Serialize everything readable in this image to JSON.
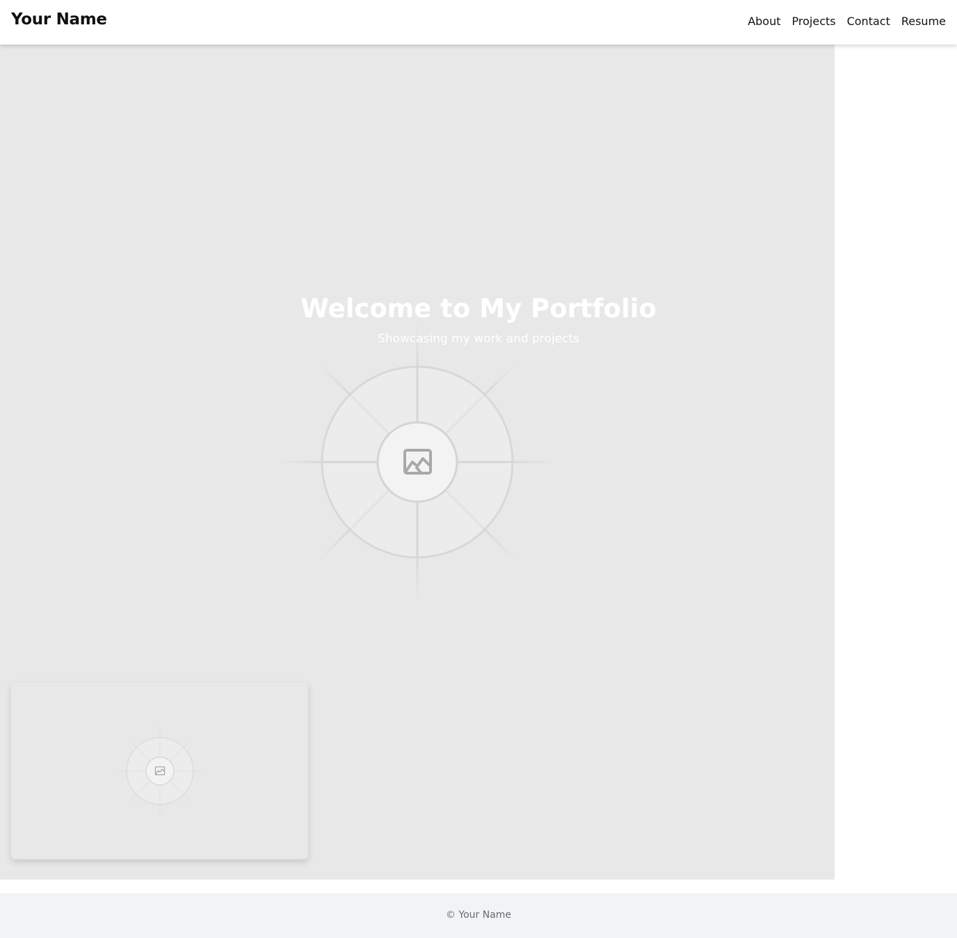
{
  "header": {
    "brand": "Your Name",
    "nav": [
      {
        "label": "About"
      },
      {
        "label": "Projects"
      },
      {
        "label": "Contact"
      },
      {
        "label": "Resume"
      }
    ]
  },
  "hero": {
    "title": "Welcome to My Portfolio",
    "subtitle": "Showcasing my work and projects",
    "placeholder_icon": "image-icon"
  },
  "project_card": {
    "placeholder_icon": "image-icon"
  },
  "footer": {
    "copyright": "© Your Name"
  },
  "colors": {
    "hero_background": "#e8e8e8",
    "footer_background": "#f2f3f5",
    "footer_text": "#666c75"
  }
}
